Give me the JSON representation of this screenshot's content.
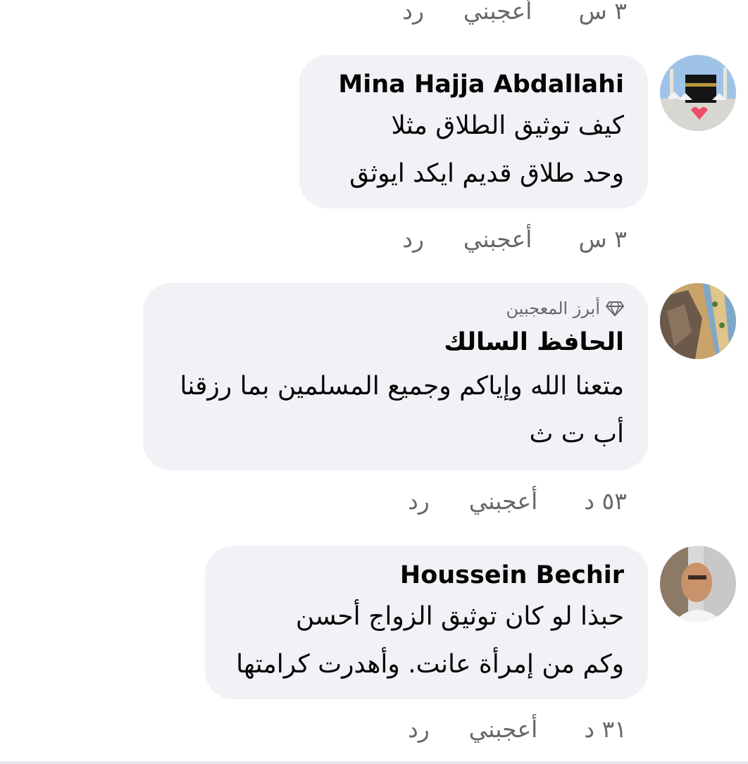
{
  "top_actions": {
    "time": "٣ س",
    "like": "أعجبني",
    "reply": "رد"
  },
  "comments": [
    {
      "name": "Mina Hajja Abdallahi",
      "lines": [
        "كيف توثيق الطلاق مثلا",
        "وحد طلاق قديم ايكد ايوثق"
      ],
      "actions": {
        "time": "٣ س",
        "like": "أعجبني",
        "reply": "رد"
      }
    },
    {
      "badge": "أبرز المعجبين",
      "name": "الحافظ السالك",
      "lines": [
        "متعنا الله وإياكم وجميع المسلمين بما رزقنا",
        "أب ت ث"
      ],
      "actions": {
        "time": "٥٣ د",
        "like": "أعجبني",
        "reply": "رد"
      }
    },
    {
      "name": "Houssein Bechir",
      "lines": [
        "حبذا لو كان توثيق الزواج  أحسن",
        "وكم من إمرأة عانت. وأهدرت كرامتها"
      ],
      "actions": {
        "time": "٣١ د",
        "like": "أعجبني",
        "reply": "رد"
      }
    }
  ],
  "colors": {
    "bubble": "#f0f2f5",
    "meta": "#65676b",
    "text": "#050505"
  }
}
